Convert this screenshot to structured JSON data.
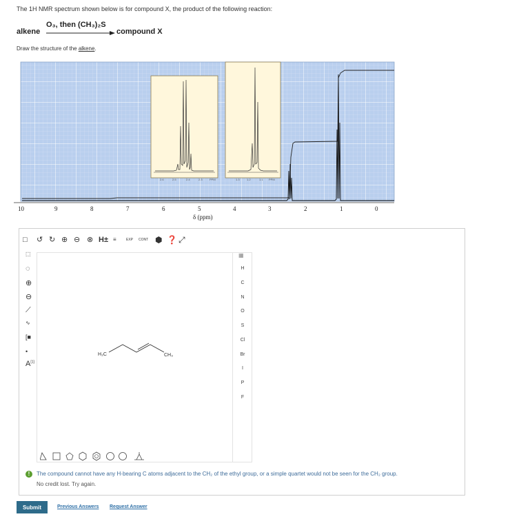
{
  "question": {
    "prompt": "The 1H NMR spectrum shown below is for compound X, the product of the following reaction:",
    "reactant": "alkene",
    "reagents": "O₃, then (CH₃)₂S",
    "product": "compound X",
    "instruction_prefix": "Draw the structure of the ",
    "instruction_link": "alkene",
    "instruction_suffix": "."
  },
  "spectrum": {
    "x_ticks": [
      "10",
      "9",
      "8",
      "7",
      "6",
      "5",
      "4",
      "3",
      "2",
      "1",
      "0"
    ],
    "x_label": "δ (ppm)",
    "inset1_ticks": [
      "2.6",
      "2.5",
      "2.4",
      "2.3",
      "PPM"
    ],
    "inset2_ticks": [
      "1.3",
      "1.2",
      "1.1",
      "PPM"
    ]
  },
  "toolbar": {
    "h_label": "H±",
    "exp_label": "EXP",
    "cont_label": "CONT"
  },
  "side_toolbar": {
    "charge_label": "A",
    "charge_super": "[1]"
  },
  "elements": [
    "H",
    "C",
    "N",
    "O",
    "S",
    "Cl",
    "Br",
    "I",
    "P",
    "F"
  ],
  "molecule": {
    "left_group": "H₃C",
    "right_group": "CH₃"
  },
  "feedback": {
    "icon": "!",
    "message": "The compound cannot have any H-bearing C atoms adjacent to the CH₂ of the ethyl group, or a simple quartet would not be seen for the CH₂ group.",
    "sub": "No credit lost. Try again."
  },
  "actions": {
    "submit": "Submit",
    "previous": "Previous Answers",
    "request": "Request Answer"
  },
  "colors": {
    "grid_bg": "#b9cfee",
    "inset_bg": "#fff7dc",
    "submit_bg": "#2e6b8a",
    "feedback_text": "#3e6c9a"
  }
}
